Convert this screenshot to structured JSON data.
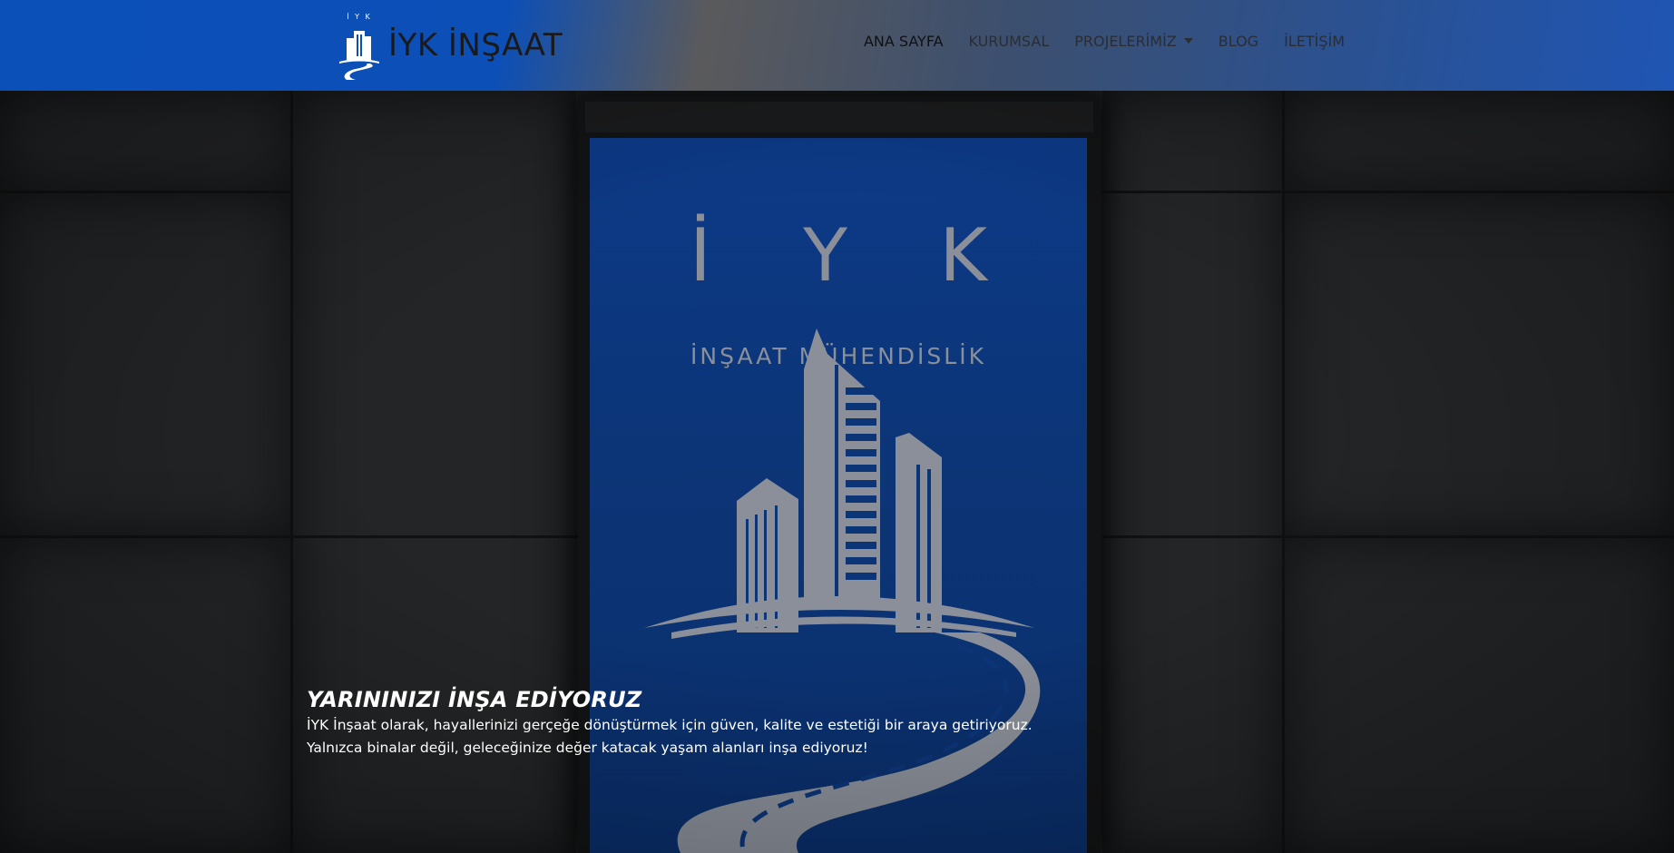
{
  "header": {
    "logo": {
      "mark_text": "İ Y K",
      "name": "İYK İNŞAAT",
      "icon": "building-road-logo-icon"
    },
    "nav": {
      "items": [
        {
          "label": "ANA SAYFA",
          "active": true
        },
        {
          "label": "KURUMSAL",
          "active": false
        },
        {
          "label": "PROJELERİMİZ",
          "active": false,
          "has_dropdown": true,
          "dropdown_icon": "caret-down-icon"
        },
        {
          "label": "BLOG",
          "active": false
        },
        {
          "label": "İLETİŞİM",
          "active": false
        }
      ]
    },
    "colors": {
      "header_blue": "#0b4fb9",
      "nav_text": "#2a2d33"
    }
  },
  "hero": {
    "poster": {
      "title": "İ Y K",
      "subtitle": "İNŞAAT MÜHENDİSLİK",
      "art_icon": "building-with-road-icon",
      "colors": {
        "poster_blue": "#0d3a88",
        "poster_gray": "#8a8f99"
      }
    },
    "heading": "YARININIZI İNŞA EDİYORUZ",
    "paragraph_lines": [
      "İYK İnşaat olarak, hayallerinizi gerçeğe dönüştürmek için güven, kalite ve estetiği bir araya getiriyoruz.",
      "Yalnızca binalar değil, geleceğinize değer katacak yaşam alanları inşa ediyoruz!"
    ]
  }
}
